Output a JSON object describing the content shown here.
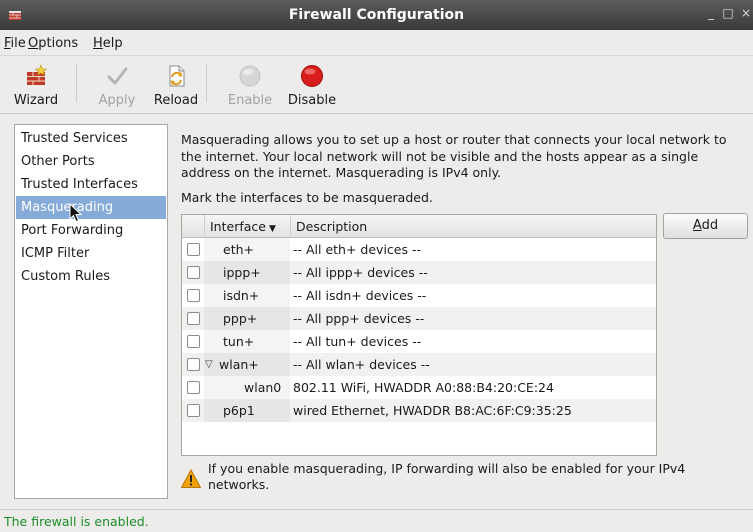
{
  "window": {
    "title": "Firewall Configuration",
    "controls": {
      "minimize": "_",
      "maximize": "□",
      "close": "×"
    }
  },
  "menubar": {
    "items": [
      {
        "mnemonic": "F",
        "rest": "ile"
      },
      {
        "mnemonic": "O",
        "rest": "ptions"
      },
      {
        "mnemonic": "H",
        "rest": "elp"
      }
    ]
  },
  "toolbar": {
    "buttons": [
      {
        "label": "Wizard",
        "icon": "wizard-icon",
        "enabled": true
      },
      {
        "label": "Apply",
        "icon": "checkmark-icon",
        "enabled": false
      },
      {
        "label": "Reload",
        "icon": "reload-icon",
        "enabled": true
      },
      {
        "label": "Enable",
        "icon": "enable-icon",
        "enabled": false
      },
      {
        "label": "Disable",
        "icon": "disable-icon",
        "enabled": true
      }
    ]
  },
  "sidebar": {
    "items": [
      {
        "label": "Trusted Services"
      },
      {
        "label": "Other Ports"
      },
      {
        "label": "Trusted Interfaces"
      },
      {
        "label": "Masquerading",
        "selected": true
      },
      {
        "label": "Port Forwarding"
      },
      {
        "label": "ICMP Filter"
      },
      {
        "label": "Custom Rules"
      }
    ],
    "selected_color": "#86abd9"
  },
  "main": {
    "description": "Masquerading allows you to set up a host or router that connects your local network to the internet. Your local network will not be visible and the hosts appear as a single address on the internet. Masquerading is IPv4 only.",
    "mark_label": "Mark the interfaces to be masqueraded.",
    "table": {
      "columns": {
        "interface": "Interface",
        "description": "Description"
      },
      "rows": [
        {
          "interface": "eth+",
          "description": "-- All eth+ devices --",
          "checked": false
        },
        {
          "interface": "ippp+",
          "description": "-- All ippp+ devices --",
          "checked": false
        },
        {
          "interface": "isdn+",
          "description": "-- All isdn+ devices --",
          "checked": false
        },
        {
          "interface": "ppp+",
          "description": "-- All ppp+ devices --",
          "checked": false
        },
        {
          "interface": "tun+",
          "description": "-- All tun+ devices --",
          "checked": false
        },
        {
          "interface": "wlan+",
          "description": "-- All wlan+ devices --",
          "checked": false,
          "expanded": true
        },
        {
          "interface": "wlan0",
          "description": "802.11 WiFi, HWADDR A0:88:B4:20:CE:24",
          "checked": false,
          "child": true
        },
        {
          "interface": "p6p1",
          "description": "wired Ethernet, HWADDR B8:AC:6F:C9:35:25",
          "checked": false
        }
      ]
    },
    "add_button": {
      "mnemonic": "A",
      "rest": "dd"
    },
    "warning": "If you enable masquerading, IP forwarding will also be enabled for your IPv4 networks."
  },
  "status": {
    "text": "The firewall is enabled.",
    "color": "#1d8d28"
  }
}
